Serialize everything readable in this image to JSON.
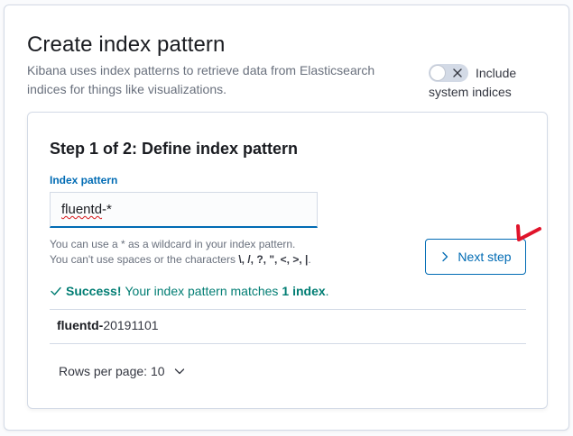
{
  "page": {
    "title": "Create index pattern",
    "description": "Kibana uses index patterns to retrieve data from Elasticsearch indices for things like visualizations."
  },
  "toggle": {
    "label_line1": "Include",
    "label_line2": "system indices",
    "checked": false
  },
  "step": {
    "title": "Step 1 of 2: Define index pattern",
    "field_label": "Index pattern",
    "input_value_underlined": "fluentd",
    "input_value_rest": "-*",
    "help_line1": "You can use a * as a wildcard in your index pattern.",
    "help_line2_prefix": "You can't use spaces or the characters",
    "help_line2_chars": "\\, /, ?, \", <, >, |",
    "help_line2_suffix": ".",
    "next_button_label": "Next step",
    "success_label": "Success!",
    "success_text": "Your index pattern matches",
    "success_count": "1 index",
    "success_end": ".",
    "index_prefix": "fluentd-",
    "index_suffix": "20191101",
    "rows_per_page_label": "Rows per page: 10"
  },
  "colors": {
    "accent": "#006bb4",
    "success": "#017d73",
    "annotation": "#e0142b"
  },
  "icons": {
    "toggle_off": "cross-icon",
    "next": "chevron-right-icon",
    "success": "check-icon",
    "rows": "chevron-down-icon"
  }
}
